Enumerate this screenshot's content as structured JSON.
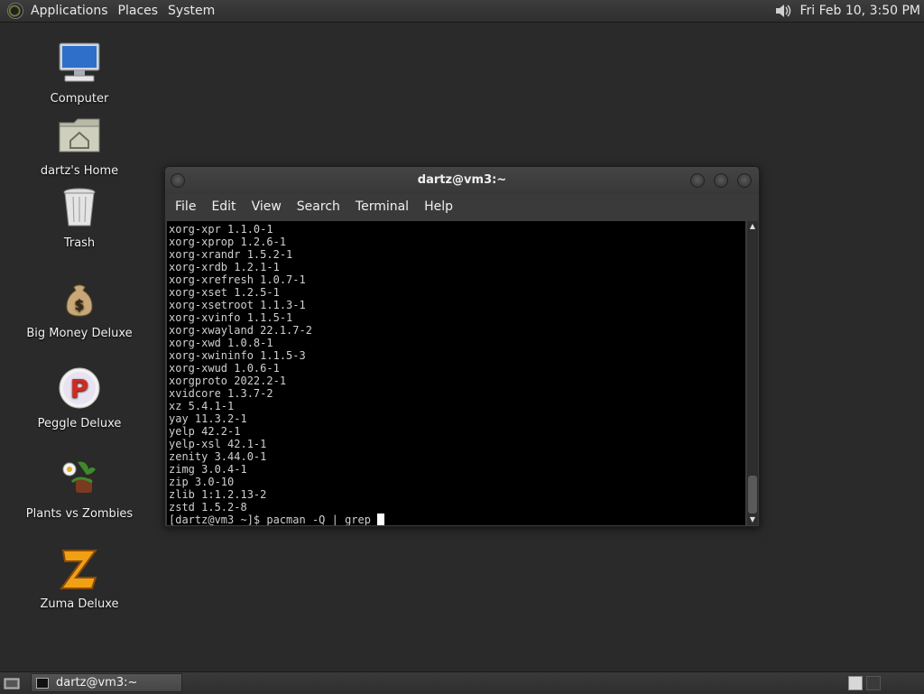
{
  "top_panel": {
    "menus": [
      "Applications",
      "Places",
      "System"
    ],
    "clock": "Fri Feb 10,  3:50 PM"
  },
  "desktop_icons": [
    {
      "label": "Computer",
      "icon": "computer-icon"
    },
    {
      "label": "dartz's Home",
      "icon": "home-folder-icon"
    },
    {
      "label": "Trash",
      "icon": "trash-icon"
    },
    {
      "label": "Big Money Deluxe",
      "icon": "money-bag-icon"
    },
    {
      "label": "Peggle Deluxe",
      "icon": "peggle-icon"
    },
    {
      "label": "Plants vs Zombies",
      "icon": "plants-vs-zombies-icon"
    },
    {
      "label": "Zuma Deluxe",
      "icon": "zuma-icon"
    }
  ],
  "window": {
    "title": "dartz@vm3:~",
    "menu": [
      "File",
      "Edit",
      "View",
      "Search",
      "Terminal",
      "Help"
    ],
    "terminal_lines": [
      "xorg-xpr 1.1.0-1",
      "xorg-xprop 1.2.6-1",
      "xorg-xrandr 1.5.2-1",
      "xorg-xrdb 1.2.1-1",
      "xorg-xrefresh 1.0.7-1",
      "xorg-xset 1.2.5-1",
      "xorg-xsetroot 1.1.3-1",
      "xorg-xvinfo 1.1.5-1",
      "xorg-xwayland 22.1.7-2",
      "xorg-xwd 1.0.8-1",
      "xorg-xwininfo 1.1.5-3",
      "xorg-xwud 1.0.6-1",
      "xorgproto 2022.2-1",
      "xvidcore 1.3.7-2",
      "xz 5.4.1-1",
      "yay 11.3.2-1",
      "yelp 42.2-1",
      "yelp-xsl 42.1-1",
      "zenity 3.44.0-1",
      "zimg 3.0.4-1",
      "zip 3.0-10",
      "zlib 1:1.2.13-2",
      "zstd 1.5.2-8"
    ],
    "prompt": "[dartz@vm3 ~]$ pacman -Q | grep "
  },
  "bottom_panel": {
    "task_label": "dartz@vm3:~"
  }
}
